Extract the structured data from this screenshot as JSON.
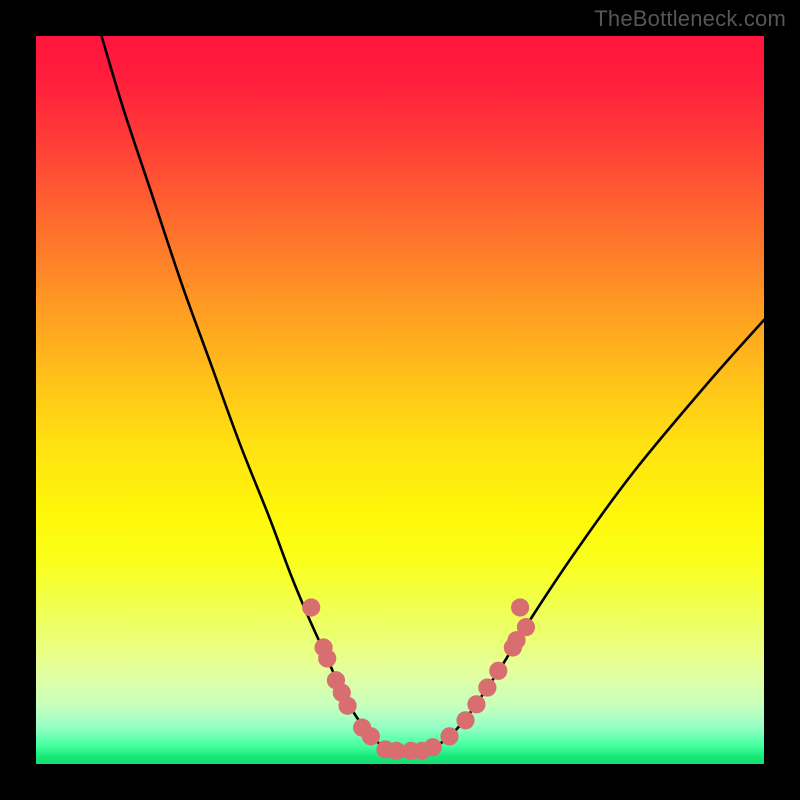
{
  "watermark": "TheBottleneck.com",
  "chart_data": {
    "type": "line",
    "title": "",
    "xlabel": "",
    "ylabel": "",
    "xlim": [
      0,
      100
    ],
    "ylim": [
      0,
      100
    ],
    "grid": false,
    "legend": false,
    "series": [
      {
        "name": "bottleneck-curve",
        "x": [
          9,
          12,
          16,
          20,
          24,
          28,
          32,
          35,
          37.5,
          40,
          42,
          44,
          46,
          47.5,
          49,
          53,
          55,
          57,
          59,
          61,
          64,
          68,
          74,
          82,
          92,
          100
        ],
        "y": [
          100,
          90,
          78,
          66,
          55,
          44,
          34,
          26,
          20,
          14.5,
          10,
          6.5,
          4,
          2.5,
          1.8,
          1.8,
          2.5,
          4,
          6.2,
          9,
          13.5,
          20,
          29,
          40,
          52,
          61
        ]
      }
    ],
    "highlighted_points": {
      "name": "benchmark-markers",
      "color": "#d86e70",
      "radius_pct": 1.25,
      "points": [
        {
          "x": 37.8,
          "y": 21.5
        },
        {
          "x": 39.5,
          "y": 16.0
        },
        {
          "x": 40.0,
          "y": 14.5
        },
        {
          "x": 41.2,
          "y": 11.5
        },
        {
          "x": 42.0,
          "y": 9.8
        },
        {
          "x": 42.8,
          "y": 8.0
        },
        {
          "x": 44.8,
          "y": 5.0
        },
        {
          "x": 46.0,
          "y": 3.8
        },
        {
          "x": 48.0,
          "y": 2.0
        },
        {
          "x": 49.5,
          "y": 1.8
        },
        {
          "x": 51.5,
          "y": 1.8
        },
        {
          "x": 53.0,
          "y": 1.8
        },
        {
          "x": 54.5,
          "y": 2.3
        },
        {
          "x": 56.8,
          "y": 3.8
        },
        {
          "x": 59.0,
          "y": 6.0
        },
        {
          "x": 60.5,
          "y": 8.2
        },
        {
          "x": 62.0,
          "y": 10.5
        },
        {
          "x": 63.5,
          "y": 12.8
        },
        {
          "x": 65.5,
          "y": 16.0
        },
        {
          "x": 66.0,
          "y": 17.0
        },
        {
          "x": 66.5,
          "y": 21.5
        },
        {
          "x": 67.3,
          "y": 18.8
        }
      ]
    }
  }
}
